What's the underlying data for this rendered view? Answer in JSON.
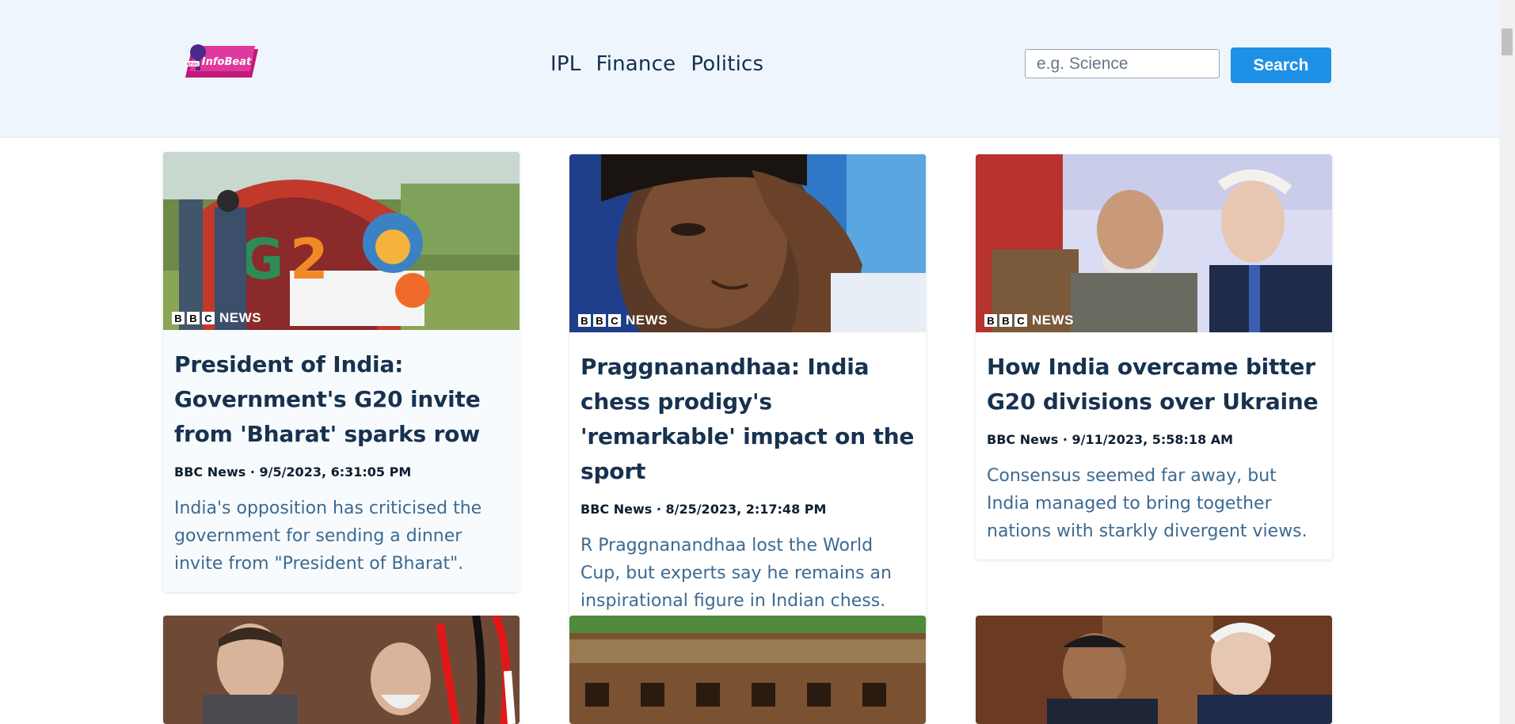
{
  "header": {
    "logo_text": "InfoBeat",
    "logo_badge": "NEWS",
    "nav": [
      "IPL",
      "Finance",
      "Politics"
    ],
    "search_placeholder": "e.g. Science",
    "search_button": "Search"
  },
  "brand_watermark": {
    "boxes": [
      "B",
      "B",
      "C"
    ],
    "word": "NEWS"
  },
  "articles": [
    {
      "title": "President of India: Government's G20 invite from 'Bharat' sparks row",
      "source": "BBC News",
      "date": "9/5/2023, 6:31:05 PM",
      "description": "India's opposition has criticised the government for sending a dinner invite from \"President of Bharat\"."
    },
    {
      "title": "Praggnanandhaa: India chess prodigy's 'remarkable' impact on the sport",
      "source": "BBC News",
      "date": "8/25/2023, 2:17:48 PM",
      "description": "R Praggnanandhaa lost the World Cup, but experts say he remains an inspirational figure in Indian chess."
    },
    {
      "title": "How India overcame bitter G20 divisions over Ukraine",
      "source": "BBC News",
      "date": "9/11/2023, 5:58:18 AM",
      "description": "Consensus seemed far away, but India managed to bring together nations with starkly divergent views."
    }
  ],
  "colors": {
    "header_bg": "#eef5fd",
    "accent": "#1e90e6",
    "title": "#17324f",
    "description": "#3c6a92"
  }
}
